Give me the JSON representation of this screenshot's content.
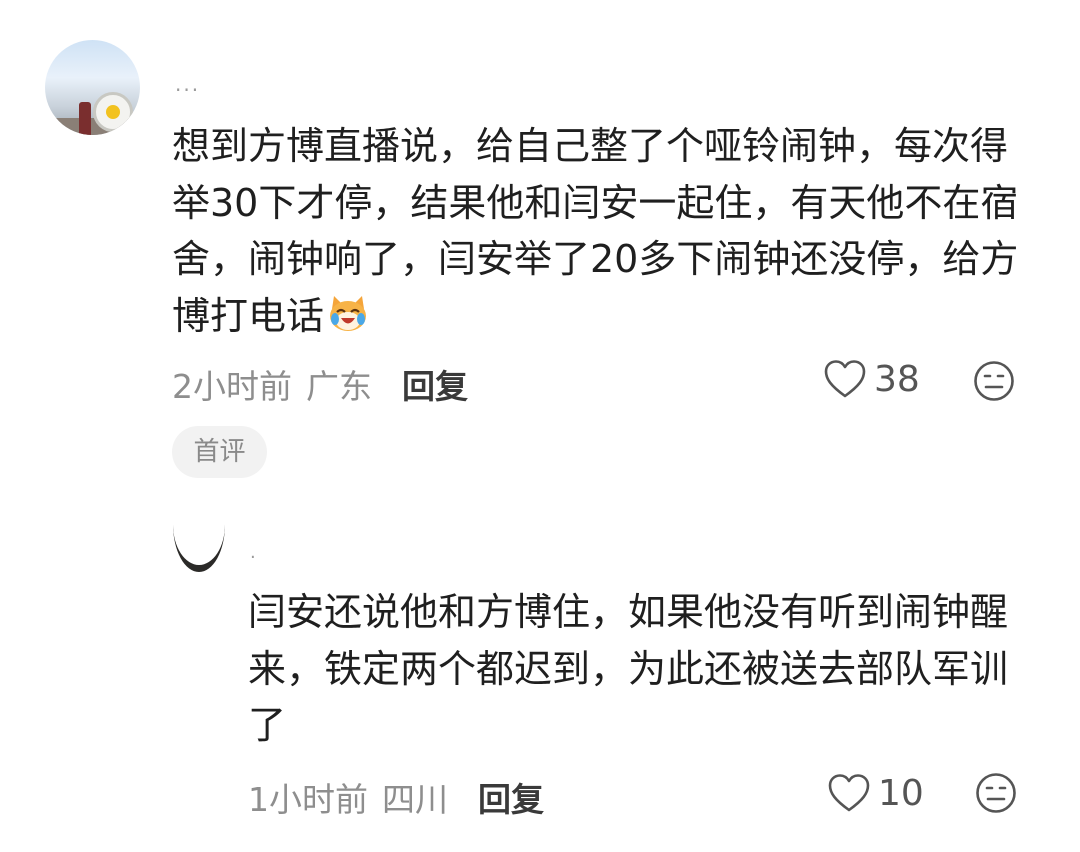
{
  "comment": {
    "username": "...",
    "text": "想到方博直播说，给自己整了个哑铃闹钟，每次得举30下才停，结果他和闫安一起住，有天他不在宿舍，闹钟响了，闫安举了20多下闹钟还没停，给方博打电话",
    "emoji": "laughing-cat-emoji",
    "time": "2小时前",
    "location": "广东",
    "reply_label": "回复",
    "likes": "38",
    "badge": "首评"
  },
  "reply": {
    "username": "·",
    "text": "闫安还说他和方博住，如果他没有听到闹钟醒来，铁定两个都迟到，为此还被送去部队军训了",
    "time": "1小时前",
    "location": "四川",
    "reply_label": "回复",
    "likes": "10"
  },
  "icons": {
    "like": "heart-outline-icon",
    "dislike": "neutral-face-icon"
  },
  "colors": {
    "text": "#1f1f1f",
    "meta": "#8e8e8e",
    "badge_bg": "#f2f2f2"
  }
}
